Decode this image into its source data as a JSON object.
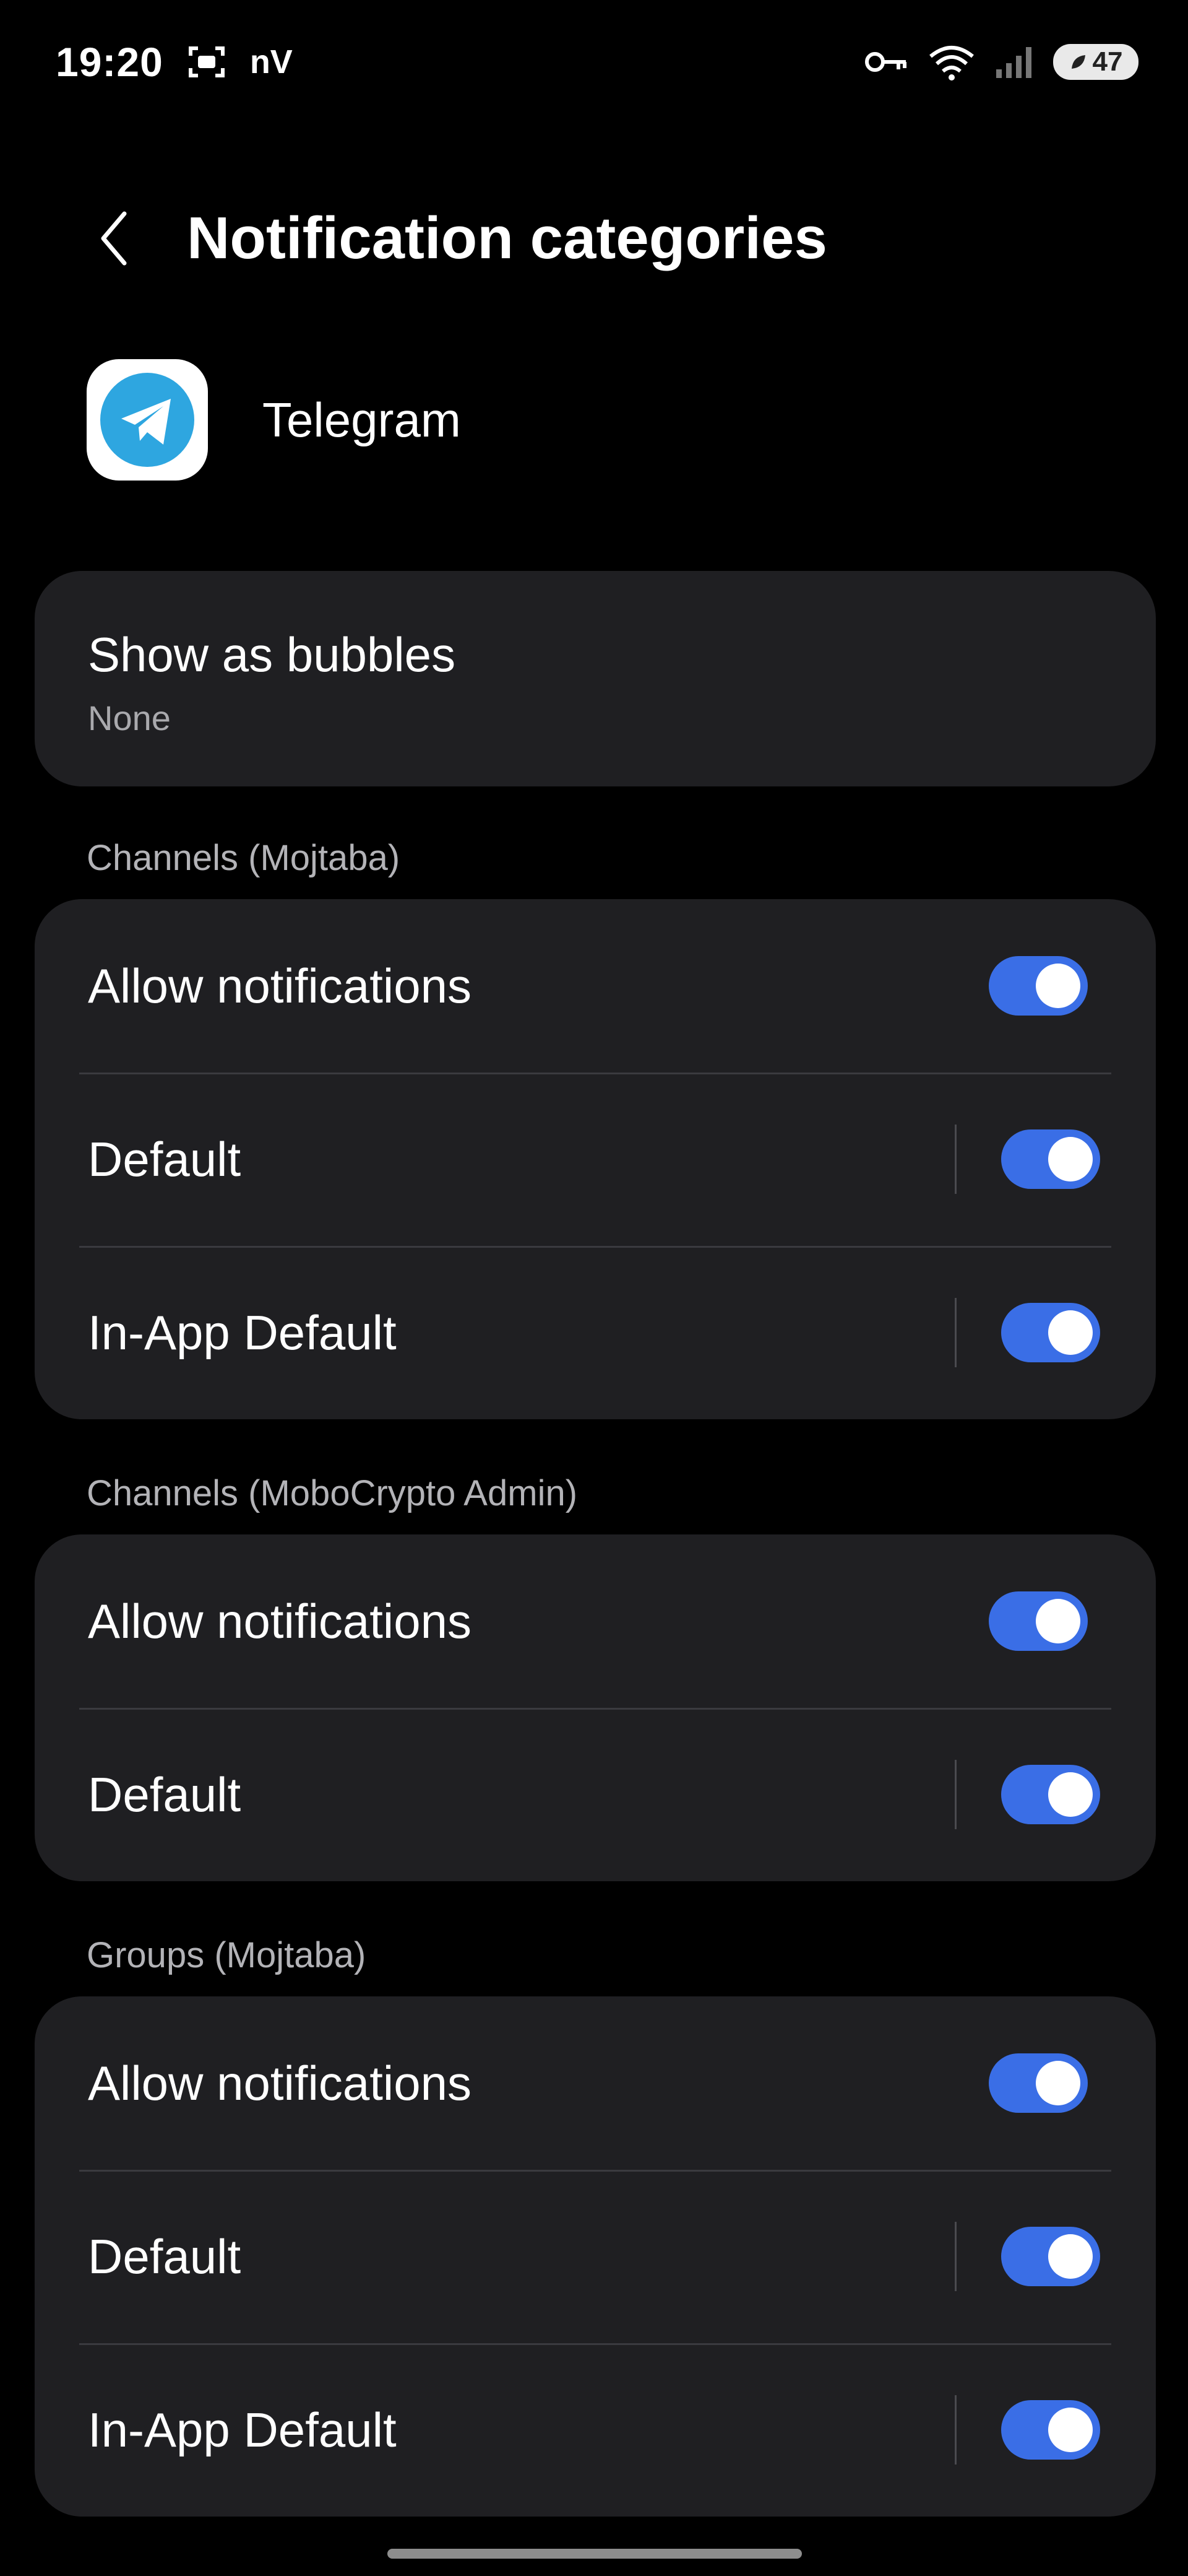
{
  "status_bar": {
    "time": "19:20",
    "carrier_text": "nV",
    "battery": "47"
  },
  "header": {
    "title": "Notification categories"
  },
  "app": {
    "name": "Telegram"
  },
  "bubbles": {
    "title": "Show as bubbles",
    "value": "None"
  },
  "sections": [
    {
      "title": "Channels (Mojtaba)",
      "rows": [
        {
          "label": "Allow notifications",
          "on": true
        },
        {
          "label": "Default",
          "on": true
        },
        {
          "label": "In-App Default",
          "on": true
        }
      ]
    },
    {
      "title": "Channels (MoboCrypto Admin)",
      "rows": [
        {
          "label": "Allow notifications",
          "on": true
        },
        {
          "label": "Default",
          "on": true
        }
      ]
    },
    {
      "title": "Groups (Mojtaba)",
      "rows": [
        {
          "label": "Allow notifications",
          "on": true
        },
        {
          "label": "Default",
          "on": true
        },
        {
          "label": "In-App Default",
          "on": true
        }
      ]
    }
  ],
  "colors": {
    "background": "#000000",
    "card": "#1f1f22",
    "toggle_on": "#3a6ee6",
    "telegram_blue": "#2ea6e0"
  }
}
